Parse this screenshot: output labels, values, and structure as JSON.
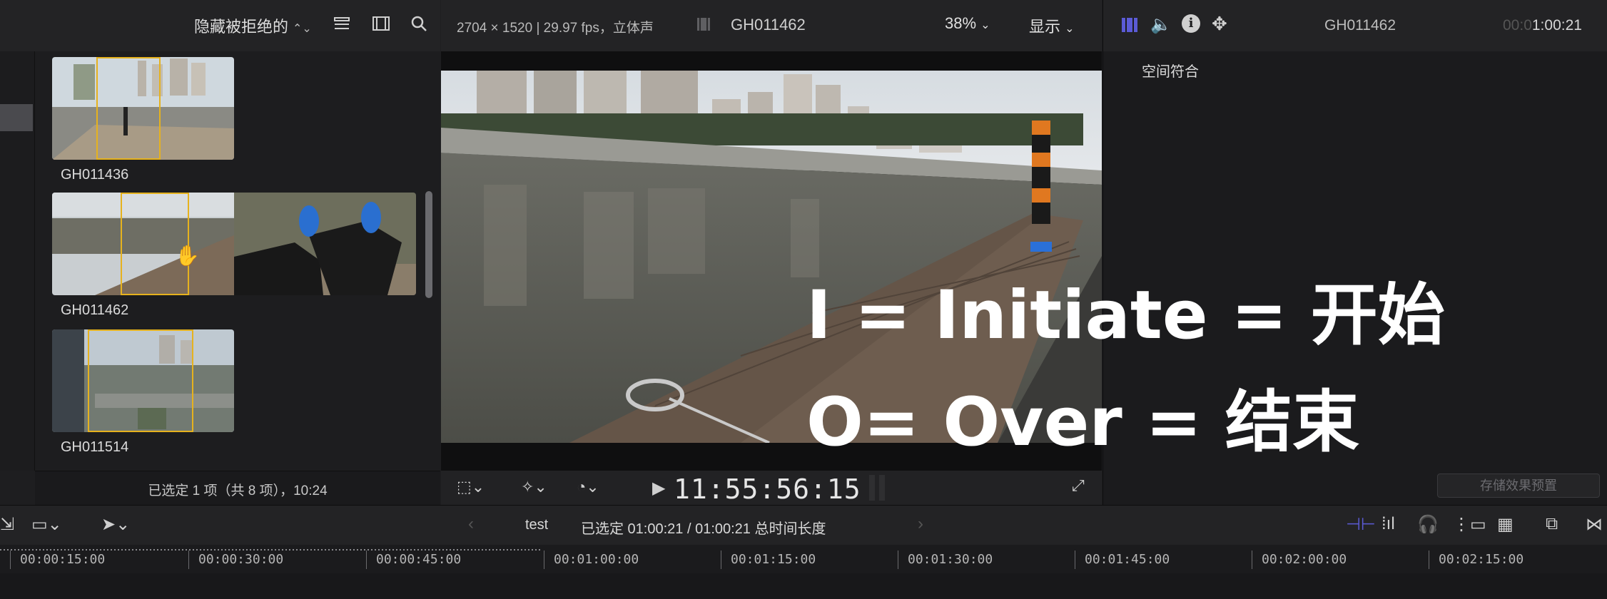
{
  "browser": {
    "filter_label": "隐藏被拒绝的",
    "clips": [
      {
        "name": "GH011436"
      },
      {
        "name": "GH011462"
      },
      {
        "name": "GH011514"
      }
    ],
    "status": "已选定 1 项（共 8 项），10:24"
  },
  "viewer": {
    "format": "2704 × 1520 | 29.97 fps，立体声",
    "clip_title": "GH011462",
    "zoom": "38%",
    "display_label": "显示",
    "timecode": "11:55:56:15"
  },
  "inspector": {
    "clip_name": "GH011462",
    "timecode_dim": "00:0",
    "timecode_bright": "1:00:21",
    "spatial_conform": "空间符合",
    "save_preset": "存储效果预置"
  },
  "overlay": {
    "line1": "I = Initiate = 开始",
    "line2": "O= Over = 结束"
  },
  "timeline": {
    "project": "test",
    "duration": "已选定 01:00:21 / 01:00:21 总时间长度",
    "ruler": [
      "00:00:15:00",
      "00:00:30:00",
      "00:00:45:00",
      "00:01:00:00",
      "00:01:15:00",
      "00:01:30:00",
      "00:01:45:00",
      "00:02:00:00",
      "00:02:15:00"
    ]
  },
  "colors": {
    "selection": "#e6b21e",
    "accent": "#5b5bd6",
    "dock_post": "#e07820"
  },
  "icons": [
    "chevron-updown-icon",
    "list-view-icon",
    "filmstrip-icon",
    "search-icon",
    "play-icon",
    "fullscreen-icon",
    "video-inspector-icon",
    "audio-inspector-icon",
    "info-icon",
    "transform-icon",
    "select-arrow-icon",
    "headphones-icon",
    "skimming-icon",
    "snapping-icon"
  ]
}
